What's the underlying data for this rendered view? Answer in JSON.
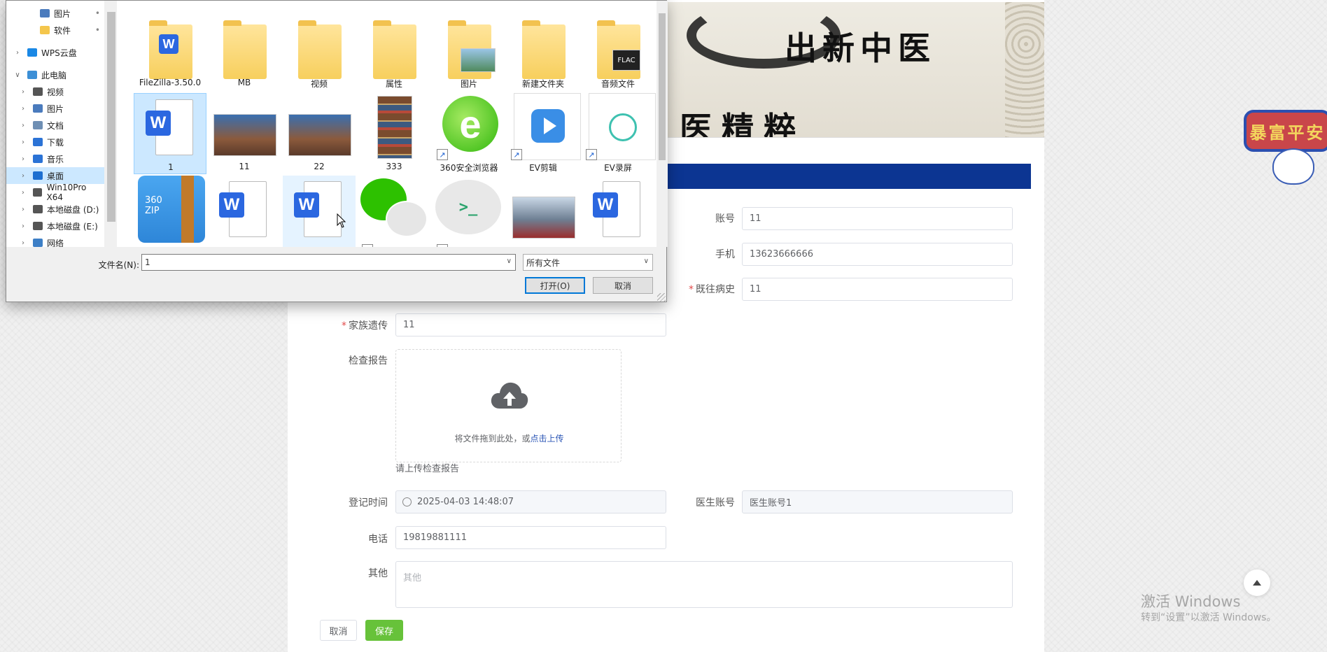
{
  "dialog": {
    "sidebar": [
      {
        "label": "图片",
        "icon": "pictures-icon",
        "pin": true
      },
      {
        "label": "软件",
        "icon": "folder-icon",
        "pin": true
      },
      {
        "label": "WPS云盘",
        "icon": "cloud-icon",
        "expand": true
      },
      {
        "label": "此电脑",
        "icon": "computer-icon",
        "expand": true,
        "open": true
      },
      {
        "label": "视频",
        "icon": "video-icon",
        "expand": true
      },
      {
        "label": "图片",
        "icon": "pictures-icon",
        "expand": true
      },
      {
        "label": "文档",
        "icon": "documents-icon",
        "expand": true
      },
      {
        "label": "下载",
        "icon": "download-icon",
        "expand": true
      },
      {
        "label": "音乐",
        "icon": "music-icon",
        "expand": true
      },
      {
        "label": "桌面",
        "icon": "desktop-icon",
        "expand": true,
        "selected": true
      },
      {
        "label": "Win10Pro X64",
        "icon": "drive-icon",
        "expand": true
      },
      {
        "label": "本地磁盘 (D:)",
        "icon": "drive-icon",
        "expand": true
      },
      {
        "label": "本地磁盘 (E:)",
        "icon": "drive-icon",
        "expand": true
      },
      {
        "label": "网络",
        "icon": "network-icon",
        "expand": true
      }
    ],
    "files": [
      {
        "name": "FileZilla-3.50.0",
        "kind": "folder-word"
      },
      {
        "name": "MB",
        "kind": "folder"
      },
      {
        "name": "视频",
        "kind": "folder"
      },
      {
        "name": "属性",
        "kind": "folder"
      },
      {
        "name": "图片",
        "kind": "folder-photo"
      },
      {
        "name": "新建文件夹",
        "kind": "folder"
      },
      {
        "name": "音频文件",
        "kind": "folder-audio"
      },
      {
        "name": "1",
        "kind": "word",
        "selected": true
      },
      {
        "name": "11",
        "kind": "photo"
      },
      {
        "name": "22",
        "kind": "photo"
      },
      {
        "name": "333",
        "kind": "books"
      },
      {
        "name": "360安全浏览器",
        "kind": "browser",
        "shortcut": true
      },
      {
        "name": "EV剪辑",
        "kind": "ev-edit",
        "shortcut": true
      },
      {
        "name": "EV录屏",
        "kind": "ev-rec",
        "shortcut": true
      },
      {
        "name": "",
        "kind": "zip"
      },
      {
        "name": "",
        "kind": "word"
      },
      {
        "name": "",
        "kind": "word",
        "hover": true
      },
      {
        "name": "",
        "kind": "wechat",
        "shortcut": true
      },
      {
        "name": "",
        "kind": "terminal",
        "shortcut": true
      },
      {
        "name": "",
        "kind": "photo-truck"
      },
      {
        "name": "",
        "kind": "word"
      }
    ],
    "filename_label": "文件名(N):",
    "filename_value": "1",
    "filetype_value": "所有文件",
    "open_button": "打开(O)",
    "cancel_button": "取消"
  },
  "banner": {
    "text1": "出新中医",
    "text2": "医精粹",
    "sticker": "暴富平安"
  },
  "form": {
    "account_label": "账号",
    "account_value": "11",
    "phone_label": "手机",
    "phone_value": "13623666666",
    "history_label": "既往病史",
    "history_value": "11",
    "family_label": "家族遗传",
    "family_value": "11",
    "report_label": "检查报告",
    "upload_text": "将文件拖到此处，或",
    "upload_link": "点击上传",
    "upload_tip": "请上传检查报告",
    "regtime_label": "登记时间",
    "regtime_value": "2025-04-03 14:48:07",
    "doctor_label": "医生账号",
    "doctor_value": "医生账号1",
    "tel_label": "电话",
    "tel_value": "19819881111",
    "other_label": "其他",
    "other_placeholder": "其他",
    "cancel_button": "取消",
    "save_button": "保存"
  },
  "watermark": {
    "line1": "激活 Windows",
    "line2": "转到“设置”以激活 Windows。"
  },
  "colors": {
    "bluebar": "#0c3592",
    "save": "#67c23a",
    "link": "#2b56b6"
  }
}
